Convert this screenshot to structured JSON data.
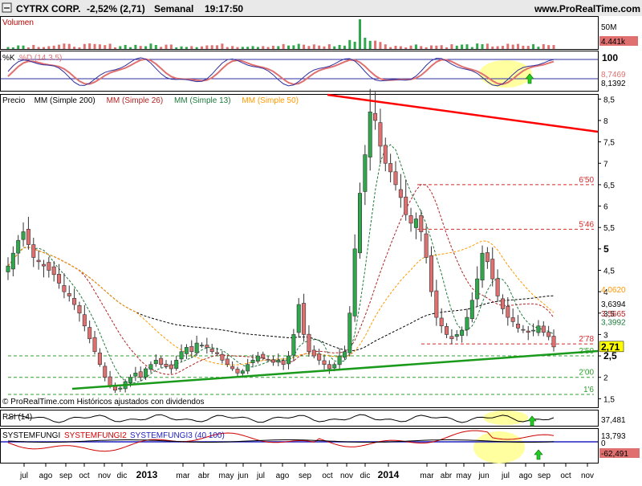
{
  "header": {
    "symbol": "CYTRX CORP.",
    "change": "-2,52% (2,71)",
    "period": "Semanal",
    "time": "19:17:50",
    "site": "www.ProRealTime.com"
  },
  "panels": {
    "volume": {
      "label": "Volumen",
      "scale_top": "50M",
      "last_value": "4.441k"
    },
    "stochastic": {
      "label_k": "%K",
      "label_d": "%D (14 3 5)",
      "scale_top": "100",
      "value_k": "8,7469",
      "value_d": "8,1392"
    },
    "price": {
      "legend": [
        {
          "text": "Precio",
          "color": "#000000"
        },
        {
          "text": "MM (Simple 200)",
          "color": "#000000"
        },
        {
          "text": "MM (Simple 26)",
          "color": "#b22222"
        },
        {
          "text": "MM (Simple 13)",
          "color": "#1e7a3c"
        },
        {
          "text": "MM (Simple 50)",
          "color": "#ff9900"
        }
      ],
      "copyright": "© ProRealTime.com  Históricos ajustados con dividendos",
      "tag_values": [
        {
          "text": "4,0620",
          "color": "#ff9900",
          "y": 4.062
        },
        {
          "text": "3,6394",
          "color": "#000000",
          "y": 3.72
        },
        {
          "text": "3,5665",
          "color": "#b22222",
          "y": 3.5
        },
        {
          "text": "3,3992",
          "color": "#1e7a3c",
          "y": 3.3
        },
        {
          "text": "2,71",
          "color": "#000000",
          "y": 2.71,
          "highlight": "#ffff00"
        }
      ]
    },
    "rsi": {
      "label": "RSI (14)",
      "value": "37,481"
    },
    "systemfungi": {
      "label1": "SYSTEMFUNGI",
      "label2": "SYSTEMFUNGI2",
      "label3": "SYSTEMFUNGI3 (40 100)",
      "value1": "13,793",
      "value2": "0",
      "value3": "-62,491"
    }
  },
  "x_axis": [
    "jul",
    "ago",
    "sep",
    "oct",
    "nov",
    "dic",
    "2013",
    "mar",
    "abr",
    "may",
    "jun",
    "jul",
    "ago",
    "sep",
    "oct",
    "nov",
    "dic",
    "2014",
    "mar",
    "abr",
    "may",
    "jun",
    "jul",
    "ago",
    "sep",
    "oct",
    "nov"
  ],
  "chart_data": {
    "type": "candlestick",
    "title": "CYTRX CORP.",
    "period": "Semanal",
    "ylim": [
      1.3,
      8.6
    ],
    "y_ticks": [
      "1,5",
      "2",
      "2,5",
      "3",
      "3,5",
      "4",
      "4,5",
      "5",
      "5,5",
      "6",
      "6,5",
      "7",
      "7,5",
      "8",
      "8,5"
    ],
    "x_start": "jul 2012",
    "x_end": "nov 2014",
    "close_series": [
      4.6,
      4.9,
      5.2,
      5.4,
      5.1,
      4.8,
      4.7,
      4.6,
      4.5,
      4.4,
      4.2,
      4.0,
      3.9,
      3.7,
      3.5,
      3.2,
      2.9,
      2.6,
      2.3,
      2.0,
      1.8,
      1.7,
      1.75,
      1.9,
      2.0,
      2.1,
      2.0,
      2.2,
      2.3,
      2.4,
      2.3,
      2.25,
      2.2,
      2.4,
      2.6,
      2.7,
      2.6,
      2.8,
      2.75,
      2.7,
      2.6,
      2.55,
      2.4,
      2.3,
      2.2,
      2.1,
      2.15,
      2.3,
      2.4,
      2.5,
      2.45,
      2.4,
      2.35,
      2.4,
      2.3,
      2.5,
      3.0,
      3.7,
      3.0,
      2.6,
      2.5,
      2.4,
      2.3,
      2.2,
      2.3,
      2.5,
      2.6,
      3.5,
      5.0,
      6.3,
      7.2,
      8.2,
      8.0,
      7.4,
      7.0,
      6.8,
      6.5,
      6.2,
      5.8,
      5.6,
      5.7,
      5.4,
      4.8,
      4.0,
      3.4,
      3.2,
      3.0,
      2.9,
      3.0,
      3.1,
      3.4,
      3.8,
      4.3,
      4.9,
      4.7,
      4.3,
      3.9,
      3.6,
      3.4,
      3.3,
      3.15,
      3.1,
      3.05,
      3.1,
      3.2,
      3.05,
      2.95,
      2.71
    ],
    "moving_averages": [
      {
        "name": "MM (Simple 200)",
        "color": "#000000",
        "last": 3.6394
      },
      {
        "name": "MM (Simple 26)",
        "color": "#b22222",
        "last": 3.5665
      },
      {
        "name": "MM (Simple 13)",
        "color": "#1e7a3c",
        "last": 3.3992
      },
      {
        "name": "MM (Simple 50)",
        "color": "#ff9900",
        "last": 4.062
      }
    ],
    "horizontal_levels": [
      {
        "label": "6'50",
        "value": 6.5,
        "color": "#d62728"
      },
      {
        "label": "5'46",
        "value": 5.46,
        "color": "#d62728"
      },
      {
        "label": "2'78",
        "value": 2.78,
        "color": "#d62728"
      },
      {
        "label": "2'50",
        "value": 2.5,
        "color": "#2ca02c"
      },
      {
        "label": "2'00",
        "value": 2.0,
        "color": "#2ca02c"
      },
      {
        "label": "1'6",
        "value": 1.6,
        "color": "#2ca02c"
      }
    ],
    "last_price": 2.71
  },
  "colors": {
    "up": "#2ea84a",
    "down": "#e07070",
    "grid": "#000000",
    "resistance": "#ff0000",
    "support": "#1a9a1a",
    "highlight_ellipse": "#ffffa0"
  }
}
